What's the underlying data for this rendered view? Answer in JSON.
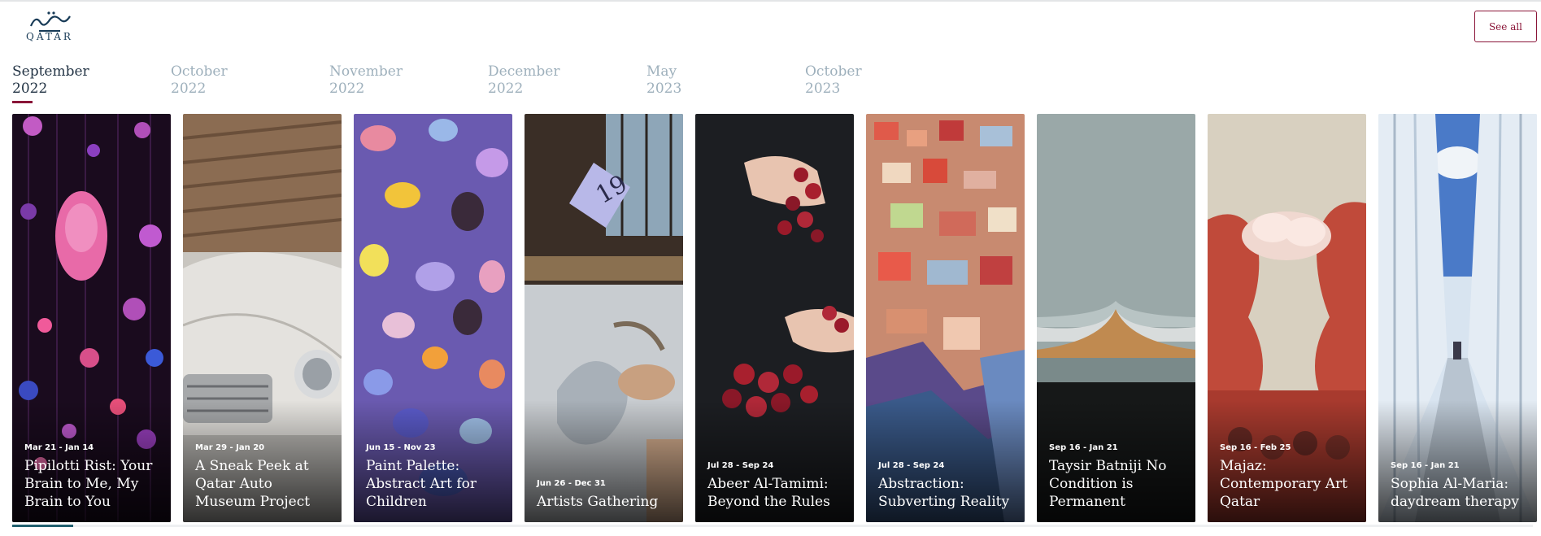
{
  "header": {
    "logo_text": "QATAR",
    "see_all_label": "See all"
  },
  "months": [
    {
      "label_month": "September",
      "label_year": "2022",
      "active": true
    },
    {
      "label_month": "October",
      "label_year": "2022",
      "active": false
    },
    {
      "label_month": "November",
      "label_year": "2022",
      "active": false
    },
    {
      "label_month": "December",
      "label_year": "2022",
      "active": false
    },
    {
      "label_month": "May",
      "label_year": "2023",
      "active": false
    },
    {
      "label_month": "October",
      "label_year": "2023",
      "active": false
    }
  ],
  "cards": [
    {
      "date": "Mar 21 - Jan 14",
      "title": "Pipilotti Rist: Your Brain to Me, My Brain to You"
    },
    {
      "date": "Mar 29 - Jan 20",
      "title": "A Sneak Peek at Qatar Auto Museum Project"
    },
    {
      "date": "Jun 15 - Nov 23",
      "title": "Paint Palette: Abstract Art for Children"
    },
    {
      "date": "Jun 26 - Dec 31",
      "title": "Artists Gathering"
    },
    {
      "date": "Jul 28 - Sep 24",
      "title": "Abeer Al-Tamimi: Beyond the Rules"
    },
    {
      "date": "Jul 28 - Sep 24",
      "title": "Abstraction: Subverting Reality"
    },
    {
      "date": "Sep 16 - Jan 21",
      "title": "Taysir Batniji No Condition is Permanent"
    },
    {
      "date": "Sep 16 - Feb 25",
      "title": "Majaz: Contemporary Art Qatar"
    },
    {
      "date": "Sep 16 - Jan 21",
      "title": "Sophia Al-Maria: daydream therapy"
    }
  ],
  "card_numeral": "19",
  "colors": {
    "brand": "#8a1538",
    "logo": "#173a56",
    "inactive_month": "#9eb0bc",
    "scroll_thumb": "#21606f"
  },
  "scroll_progress": 0.04
}
